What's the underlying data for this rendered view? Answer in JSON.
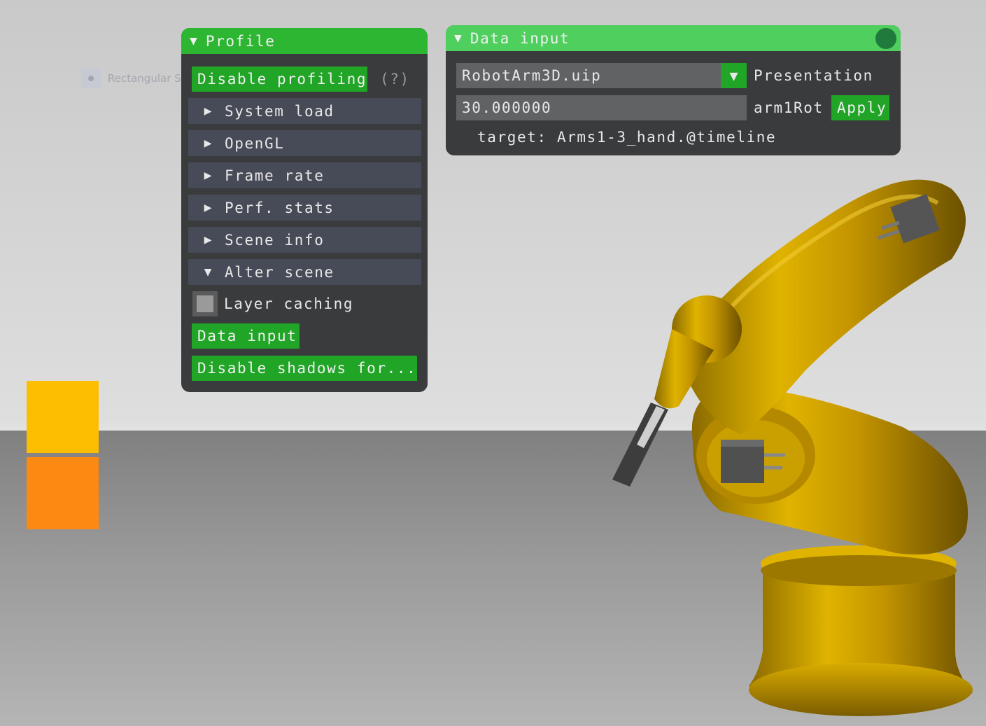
{
  "background_ghost": {
    "text": "Rectangular Sn"
  },
  "profile_window": {
    "title": "Profile",
    "disable_profiling": "Disable profiling",
    "help": "(?)",
    "sections": [
      {
        "label": "System load",
        "expanded": false
      },
      {
        "label": "OpenGL",
        "expanded": false
      },
      {
        "label": "Frame rate",
        "expanded": false
      },
      {
        "label": "Perf. stats",
        "expanded": false
      },
      {
        "label": "Scene info",
        "expanded": false
      },
      {
        "label": "Alter scene",
        "expanded": true
      }
    ],
    "layer_caching": {
      "label": "Layer caching",
      "checked": false
    },
    "data_input_button": "Data input",
    "disable_shadows_button": "Disable shadows for..."
  },
  "data_input_window": {
    "title": "Data input",
    "presentation_select": {
      "value": "RobotArm3D.uip",
      "label": "Presentation"
    },
    "value_field": {
      "value": "30.000000",
      "label": "arm1Rot"
    },
    "apply_label": "Apply",
    "target_text": "target: Arms1-3_hand.@timeline"
  },
  "colors": {
    "accent_green": "#21a526",
    "title_green": "#2db632",
    "panel_bg": "#3a3b3d",
    "square_yellow": "#fdbd00",
    "square_orange": "#fc8a12",
    "robot_gold": "#c99a00"
  }
}
